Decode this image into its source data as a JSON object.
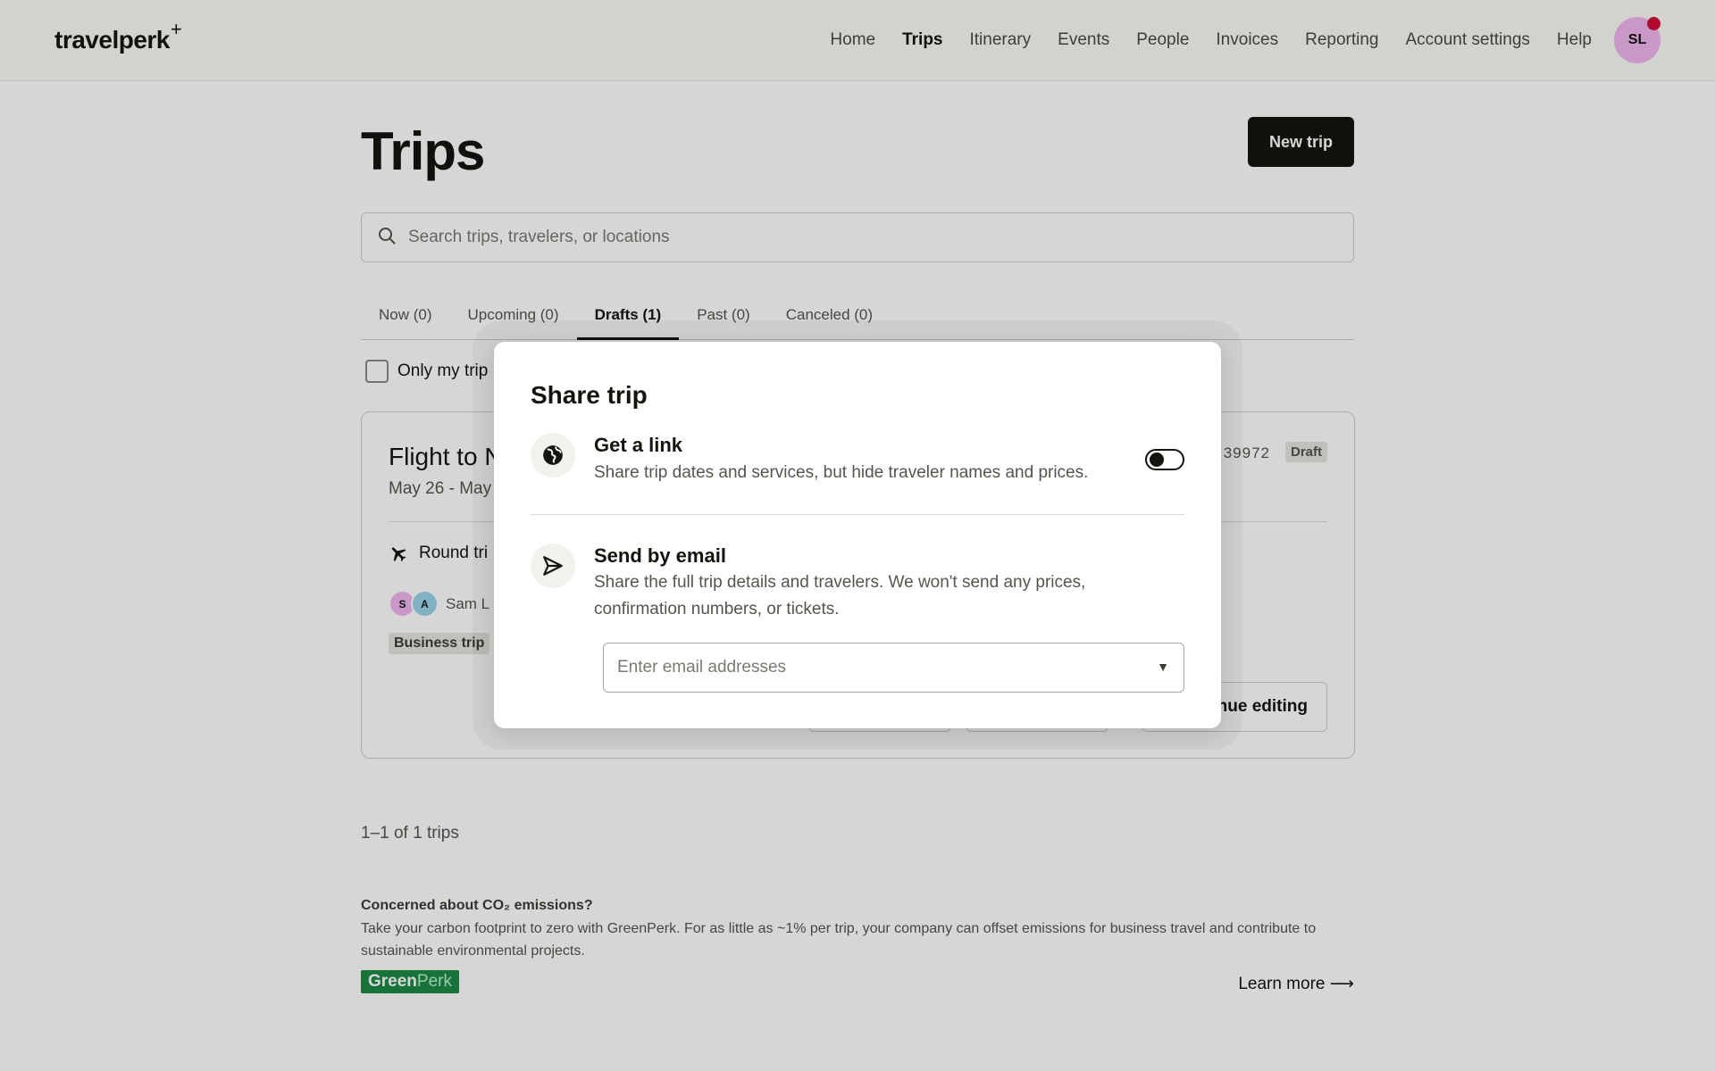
{
  "header": {
    "logo": "travelperk",
    "logo_plus": "+",
    "nav": [
      "Home",
      "Trips",
      "Itinerary",
      "Events",
      "People",
      "Invoices",
      "Reporting",
      "Account settings",
      "Help"
    ],
    "active_nav": "Trips",
    "avatar_initials": "SL"
  },
  "page": {
    "title": "Trips",
    "new_trip_label": "New trip",
    "search_placeholder": "Search trips, travelers, or locations",
    "tabs": [
      "Now (0)",
      "Upcoming (0)",
      "Drafts (1)",
      "Past (0)",
      "Canceled (0)"
    ],
    "active_tab": "Drafts (1)",
    "only_mine_label": "Only my trip"
  },
  "trip_card": {
    "title": "Flight to N",
    "dates": "May 26 - May",
    "trip_id": "39972",
    "status": "Draft",
    "trip_type": "Round tri",
    "traveler_initials": [
      "S",
      "A"
    ],
    "traveler_name": "Sam L",
    "tag": "Business trip",
    "continue_label": "nue editing"
  },
  "footer": {
    "pager": "1–1 of 1 trips",
    "co2_title": "Concerned about CO₂ emissions?",
    "co2_text": "Take your carbon footprint to zero with GreenPerk. For as little as ~1% per trip, your company can offset emissions for business travel and contribute to sustainable environmental projects.",
    "greenperk_a": "Green",
    "greenperk_b": "Perk",
    "learn_more": "Learn more ⟶"
  },
  "modal": {
    "title": "Share trip",
    "link": {
      "title": "Get a link",
      "description": "Share trip dates and services, but hide traveler names and prices.",
      "enabled": false
    },
    "email": {
      "title": "Send by email",
      "description": "Share the full trip details and travelers. We won't send any prices, confirmation numbers, or tickets.",
      "placeholder": "Enter email addresses"
    }
  },
  "colors": {
    "accent": "#14140f",
    "greenperk": "#1c8a45",
    "avatar": "#f0b5f0",
    "notification": "#d10f3a"
  }
}
